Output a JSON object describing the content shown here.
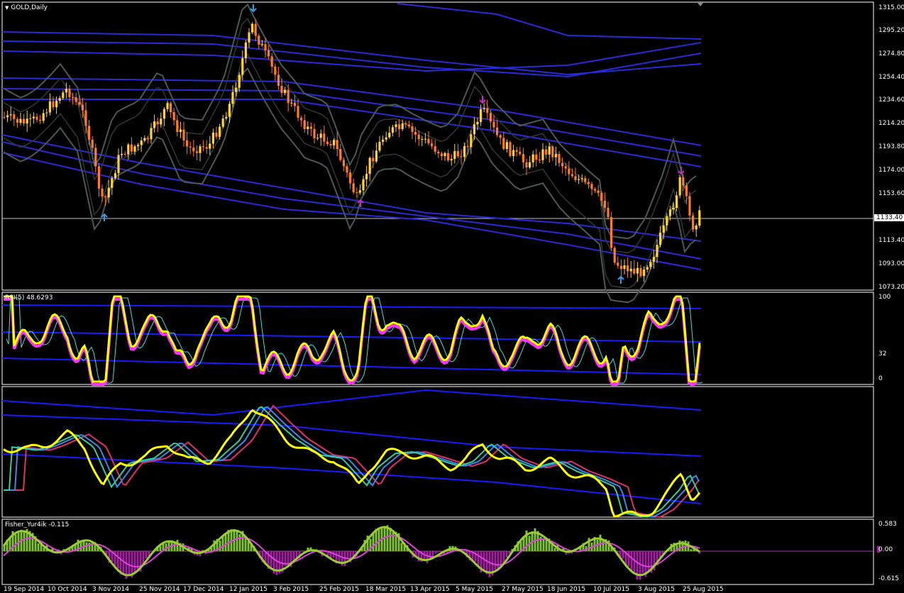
{
  "window": {
    "title": "GOLD,Daily"
  },
  "rsi_label": "RSI(5) 48.6293",
  "fisher_label": "Fisher_Yur4ik -0.115",
  "price_axis": {
    "labels": [
      "1315.00",
      "1295.20",
      "1274.80",
      "1254.40",
      "1234.60",
      "1214.20",
      "1193.80",
      "1174.00",
      "1153.60",
      "1133.40",
      "1113.40",
      "1093.00",
      "1073.20"
    ],
    "current": "1133.40"
  },
  "rsi_axis": {
    "labels": [
      "100",
      "32",
      "0"
    ]
  },
  "fisher_axis": {
    "labels": [
      "0.583",
      "0.00",
      "-0.615"
    ]
  },
  "time_axis": {
    "labels": [
      "19 Sep 2014",
      "10 Oct 2014",
      "3 Nov 2014",
      "25 Nov 2014",
      "17 Dec 2014",
      "12 Jan 2015",
      "3 Feb 2015",
      "25 Feb 2015",
      "18 Mar 2015",
      "13 Apr 2015",
      "5 May 2015",
      "27 May 2015",
      "18 Jun 2015",
      "10 Jul 2015",
      "3 Aug 2015",
      "25 Aug 2015"
    ]
  },
  "colors": {
    "bull": "#ffd23a",
    "bear": "#ff7a2a",
    "envelope": "#2a2ad8",
    "band": "#4a5a55",
    "rsi": "#ffff00",
    "rsi_shadow": "#ff33ff",
    "fisher_pos": "#7dc23a",
    "fisher_neg": "#a020a0",
    "fisher_line": "#9acd32",
    "fisher_signal": "#e040e0"
  },
  "icons": [
    "arrow-up-icon",
    "arrow-down-icon",
    "dropdown-triangle-icon"
  ]
}
